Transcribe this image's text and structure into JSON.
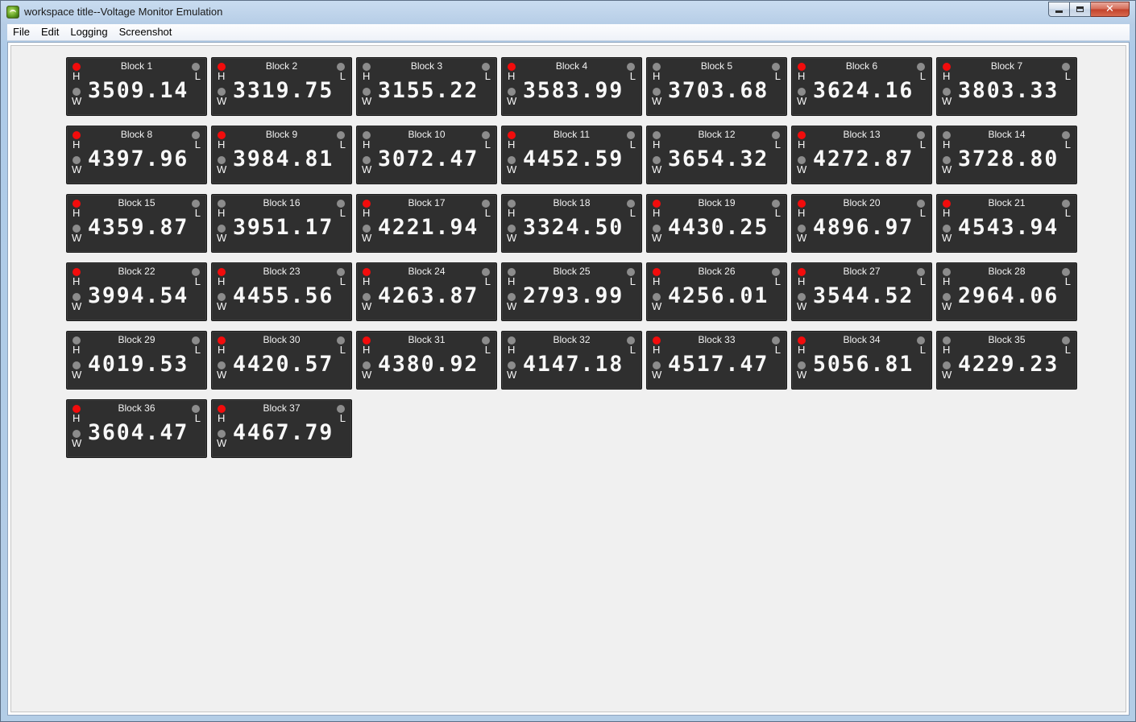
{
  "window": {
    "title": "workspace title--Voltage Monitor  Emulation"
  },
  "menu": [
    "File",
    "Edit",
    "Logging",
    "Screenshot"
  ],
  "indicator_labels": {
    "high": "H",
    "warning": "W",
    "low": "L"
  },
  "indicator_colors": {
    "on": "#f20c0c",
    "off": "#8c8c8c"
  },
  "blocks": [
    {
      "name": "Block 1",
      "value": "3509.14",
      "h_on": true
    },
    {
      "name": "Block 2",
      "value": "3319.75",
      "h_on": true
    },
    {
      "name": "Block 3",
      "value": "3155.22",
      "h_on": false
    },
    {
      "name": "Block 4",
      "value": "3583.99",
      "h_on": true
    },
    {
      "name": "Block 5",
      "value": "3703.68",
      "h_on": false
    },
    {
      "name": "Block 6",
      "value": "3624.16",
      "h_on": true
    },
    {
      "name": "Block 7",
      "value": "3803.33",
      "h_on": true
    },
    {
      "name": "Block 8",
      "value": "4397.96",
      "h_on": true
    },
    {
      "name": "Block 9",
      "value": "3984.81",
      "h_on": true
    },
    {
      "name": "Block 10",
      "value": "3072.47",
      "h_on": false
    },
    {
      "name": "Block 11",
      "value": "4452.59",
      "h_on": true
    },
    {
      "name": "Block 12",
      "value": "3654.32",
      "h_on": false
    },
    {
      "name": "Block 13",
      "value": "4272.87",
      "h_on": true
    },
    {
      "name": "Block 14",
      "value": "3728.80",
      "h_on": false
    },
    {
      "name": "Block 15",
      "value": "4359.87",
      "h_on": true
    },
    {
      "name": "Block 16",
      "value": "3951.17",
      "h_on": false
    },
    {
      "name": "Block 17",
      "value": "4221.94",
      "h_on": true
    },
    {
      "name": "Block 18",
      "value": "3324.50",
      "h_on": false
    },
    {
      "name": "Block 19",
      "value": "4430.25",
      "h_on": true
    },
    {
      "name": "Block 20",
      "value": "4896.97",
      "h_on": true
    },
    {
      "name": "Block 21",
      "value": "4543.94",
      "h_on": true
    },
    {
      "name": "Block 22",
      "value": "3994.54",
      "h_on": true
    },
    {
      "name": "Block 23",
      "value": "4455.56",
      "h_on": true
    },
    {
      "name": "Block 24",
      "value": "4263.87",
      "h_on": true
    },
    {
      "name": "Block 25",
      "value": "2793.99",
      "h_on": false
    },
    {
      "name": "Block 26",
      "value": "4256.01",
      "h_on": true
    },
    {
      "name": "Block 27",
      "value": "3544.52",
      "h_on": true
    },
    {
      "name": "Block 28",
      "value": "2964.06",
      "h_on": false
    },
    {
      "name": "Block 29",
      "value": "4019.53",
      "h_on": false
    },
    {
      "name": "Block 30",
      "value": "4420.57",
      "h_on": true
    },
    {
      "name": "Block 31",
      "value": "4380.92",
      "h_on": true
    },
    {
      "name": "Block 32",
      "value": "4147.18",
      "h_on": false
    },
    {
      "name": "Block 33",
      "value": "4517.47",
      "h_on": true
    },
    {
      "name": "Block 34",
      "value": "5056.81",
      "h_on": true
    },
    {
      "name": "Block 35",
      "value": "4229.23",
      "h_on": false
    },
    {
      "name": "Block 36",
      "value": "3604.47",
      "h_on": true
    },
    {
      "name": "Block 37",
      "value": "4467.79",
      "h_on": true
    }
  ]
}
